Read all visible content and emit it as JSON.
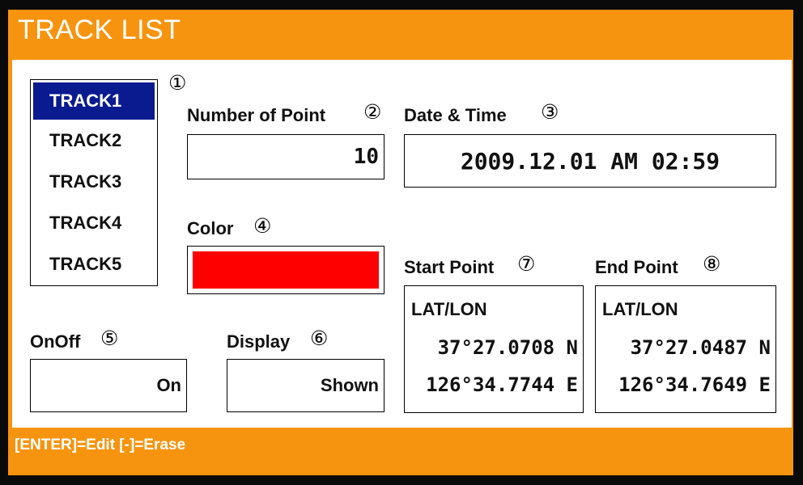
{
  "title": "TRACK LIST",
  "footer": "[ENTER]=Edit [-]=Erase",
  "markers": {
    "m1": "①",
    "m2": "②",
    "m3": "③",
    "m4": "④",
    "m5": "⑤",
    "m6": "⑥",
    "m7": "⑦",
    "m8": "⑧"
  },
  "tracks": [
    "TRACK1",
    "TRACK2",
    "TRACK3",
    "TRACK4",
    "TRACK5"
  ],
  "selected_track": "TRACK1",
  "number_of_point": {
    "label": "Number of Point",
    "value": "10"
  },
  "date_time": {
    "label": "Date & Time",
    "value": "2009.12.01 AM 02:59"
  },
  "color": {
    "label": "Color",
    "swatch": "#ff0000"
  },
  "onoff": {
    "label": "OnOff",
    "value": "On"
  },
  "display": {
    "label": "Display",
    "value": "Shown"
  },
  "start_point": {
    "label": "Start Point",
    "header": "LAT/LON",
    "lat": "37°27.0708 N",
    "lon": "126°34.7744 E"
  },
  "end_point": {
    "label": "End Point",
    "header": "LAT/LON",
    "lat": "37°27.0487 N",
    "lon": "126°34.7649 E"
  },
  "colors": {
    "accent": "#f7940f",
    "selection": "#0a1a8f",
    "frame": "#0a0a0a"
  }
}
